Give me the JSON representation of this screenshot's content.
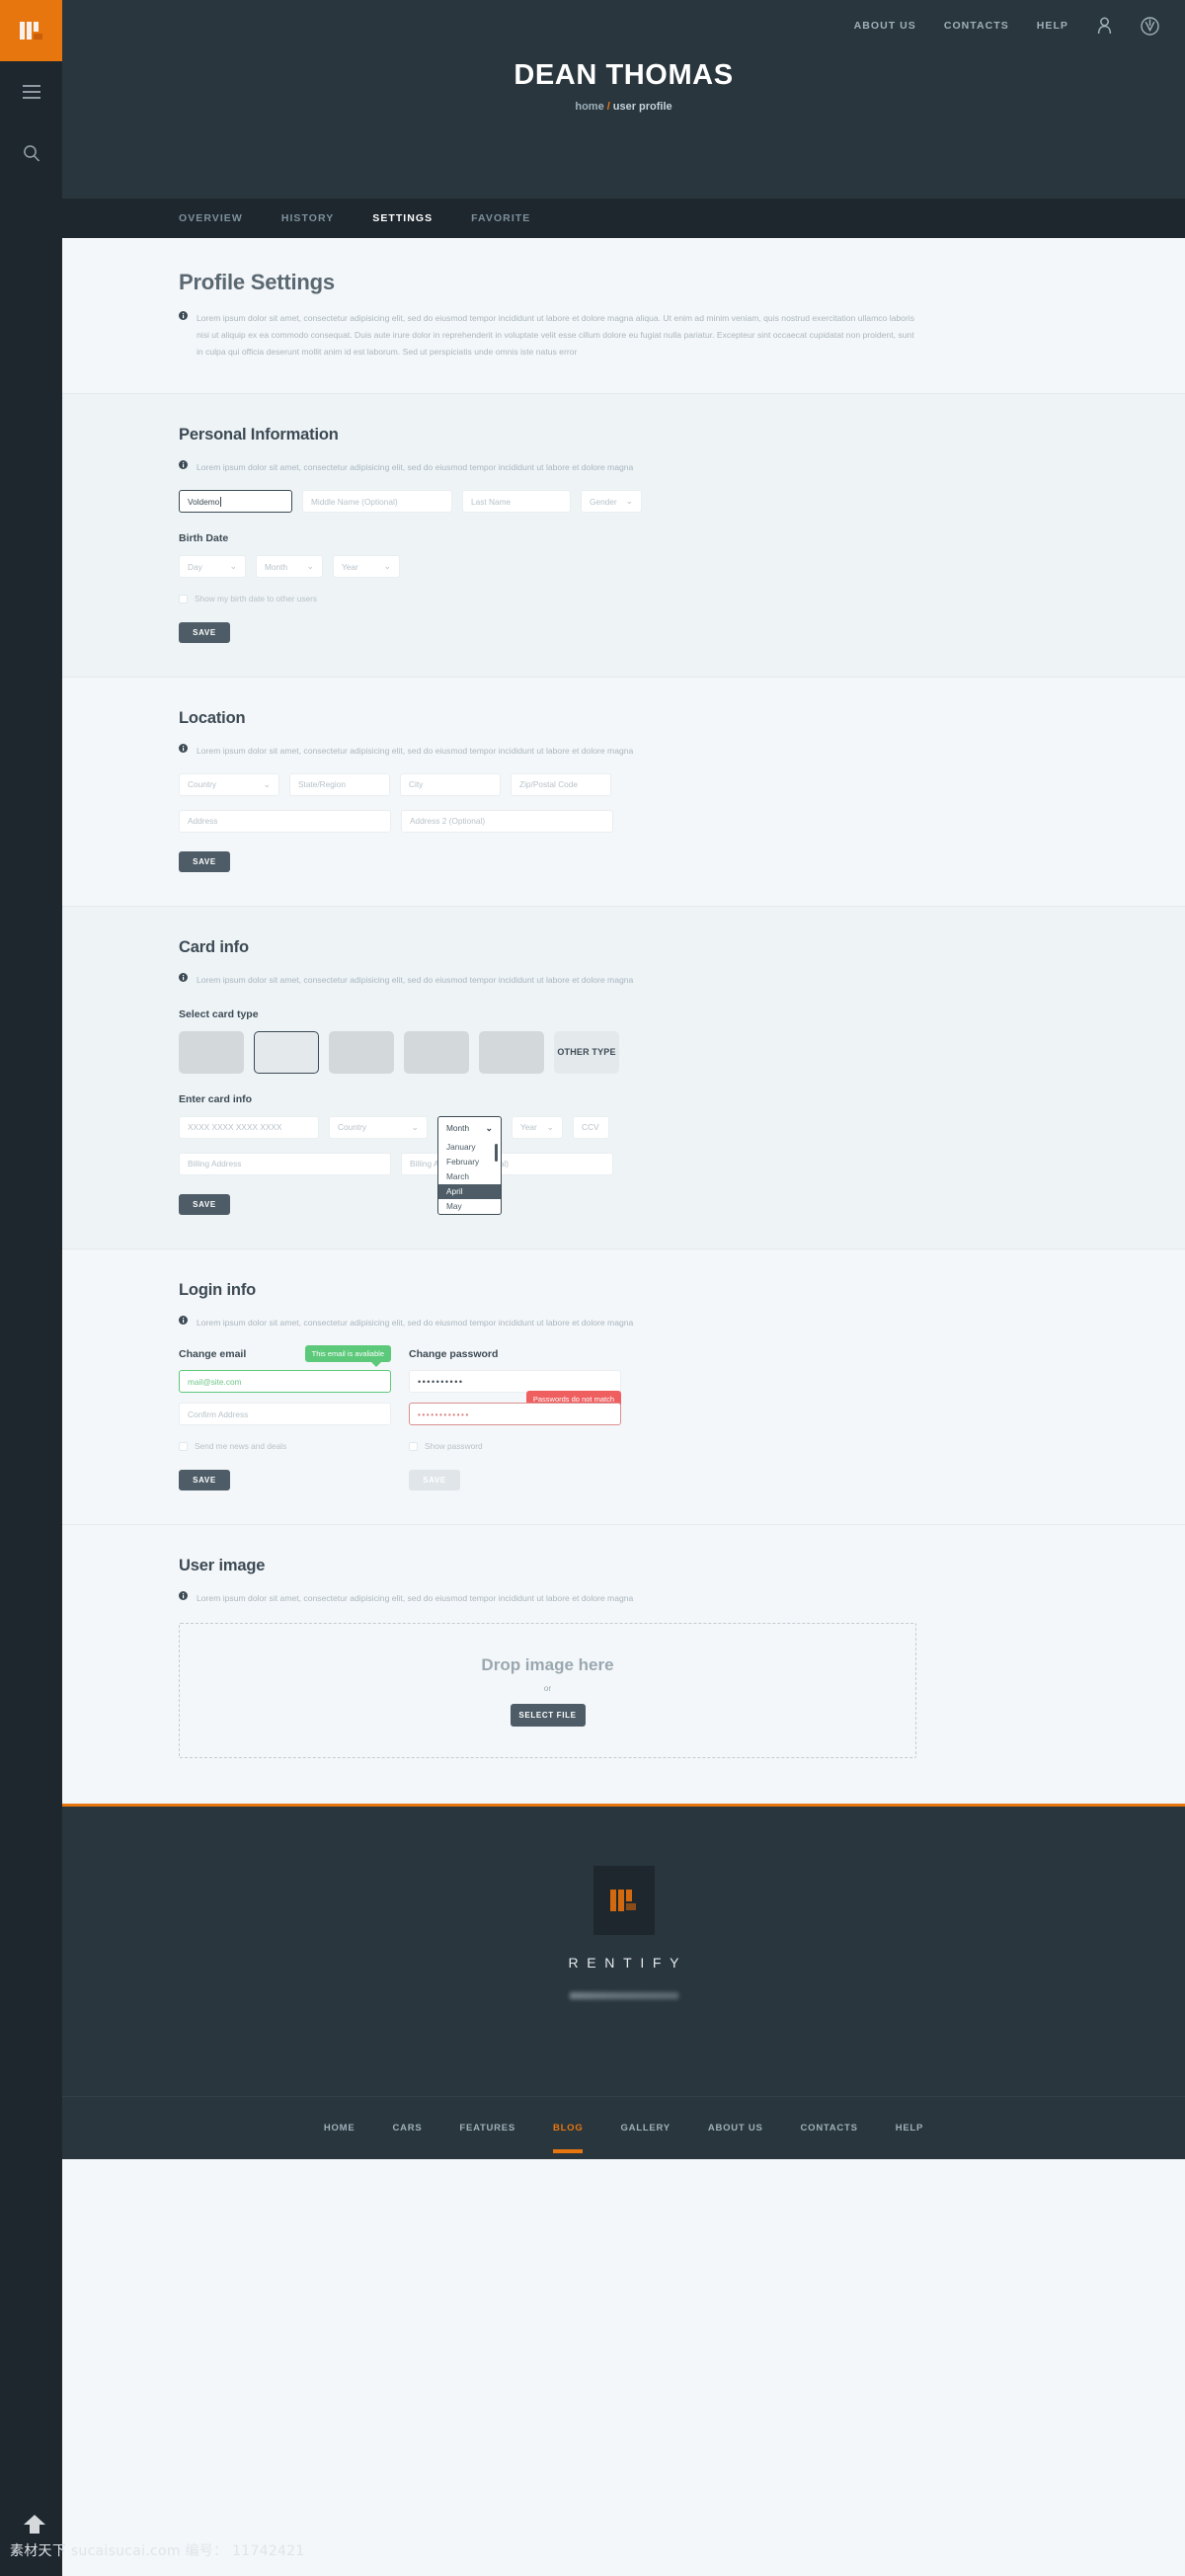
{
  "brand": {
    "accent": "#e8760f",
    "dark": "#1e272e",
    "header": "#29363d",
    "body_bg": "#f4f7f9"
  },
  "rail": {
    "logo_name": "rentify-logo-mark",
    "menu_label": "menu-icon",
    "search_label": "search-icon"
  },
  "topnav": {
    "links": [
      "ABOUT US",
      "CONTACTS",
      "HELP"
    ],
    "user_icon": "user-icon",
    "logo_icon": "brand-circle-icon"
  },
  "hero": {
    "title": "DEAN THOMAS",
    "crumb_home": "home",
    "crumb_sep": "/",
    "crumb_current": "user profile"
  },
  "tabs": [
    {
      "label": "OVERVIEW",
      "active": false
    },
    {
      "label": "HISTORY",
      "active": false
    },
    {
      "label": "SETTINGS",
      "active": true
    },
    {
      "label": "FAVORITE",
      "active": false
    }
  ],
  "page": {
    "title": "Profile Settings",
    "intro": "Lorem ipsum dolor sit amet, consectetur adipisicing elit, sed do eiusmod tempor incididunt ut labore et dolore magna aliqua. Ut enim ad minim veniam, quis nostrud exercitation ullamco laboris nisi ut aliquip ex ea commodo consequat. Duis aute irure dolor in reprehenderit in voluptate velit esse cillum dolore eu fugiat nulla pariatur. Excepteur sint occaecat cupidatat non proident, sunt in culpa qui officia deserunt mollit anim id est laborum. Sed ut perspiciatis unde omnis iste natus error"
  },
  "short_note": "Lorem ipsum dolor sit amet, consectetur adipisicing elit, sed do eiusmod tempor incididunt ut labore et dolore magna",
  "personal": {
    "title": "Personal Information",
    "first_name_value": "Voldemo",
    "middle_name_placeholder": "Middle Name (Optional)",
    "last_name_placeholder": "Last Name",
    "gender_placeholder": "Gender",
    "birth_label": "Birth Date",
    "day_placeholder": "Day",
    "month_placeholder": "Month",
    "year_placeholder": "Year",
    "show_birth_label": "Show my birth date to other users",
    "save_label": "SAVE"
  },
  "location": {
    "title": "Location",
    "country_placeholder": "Country",
    "state_placeholder": "State/Region",
    "city_placeholder": "City",
    "zip_placeholder": "Zip/Postal Code",
    "address_placeholder": "Address",
    "address2_placeholder": "Address 2 (Optional)",
    "save_label": "SAVE"
  },
  "card": {
    "title": "Card info",
    "select_label": "Select card type",
    "other_type_label": "OTHER TYPE",
    "enter_label": "Enter card info",
    "number_placeholder": "XXXX XXXX XXXX XXXX",
    "country_placeholder": "Country",
    "month_placeholder": "Month",
    "year_placeholder": "Year",
    "ccv_placeholder": "CCV",
    "billing_placeholder": "Billing Address",
    "billing2_placeholder": "Billing Address 2 (Optional)",
    "save_label": "SAVE",
    "month_dropdown": {
      "open": true,
      "head": "Month",
      "options": [
        "January",
        "February",
        "March",
        "April",
        "May"
      ],
      "highlighted": "April"
    }
  },
  "login": {
    "title": "Login info",
    "email_col_label": "Change email",
    "password_col_label": "Change password",
    "email_value": "mail@site.com",
    "email_tip": "This email is avaliable",
    "confirm_placeholder": "Confirm Address",
    "password_value": "••••••••••",
    "confirm_password_value": "••••••••••••",
    "password_tip": "Passwords do not match",
    "news_checkbox_label": "Send me news and deals",
    "show_password_label": "Show password",
    "email_save_label": "SAVE",
    "password_save_label": "SAVE"
  },
  "user_image": {
    "title": "User image",
    "drop_title": "Drop image here",
    "or": "or",
    "select_label": "SELECT FILE"
  },
  "footer": {
    "brand_name": "RENTIFY",
    "logo_icon": "rentify-footer-logo"
  },
  "botnav": [
    {
      "label": "HOME",
      "active": false
    },
    {
      "label": "CARS",
      "active": false
    },
    {
      "label": "FEATURES",
      "active": false
    },
    {
      "label": "BLOG",
      "active": true
    },
    {
      "label": "GALLERY",
      "active": false
    },
    {
      "label": "ABOUT US",
      "active": false
    },
    {
      "label": "CONTACTS",
      "active": false
    },
    {
      "label": "HELP",
      "active": false
    }
  ],
  "watermark": "素材天下 sucaisucai.com  编号： 11742421"
}
